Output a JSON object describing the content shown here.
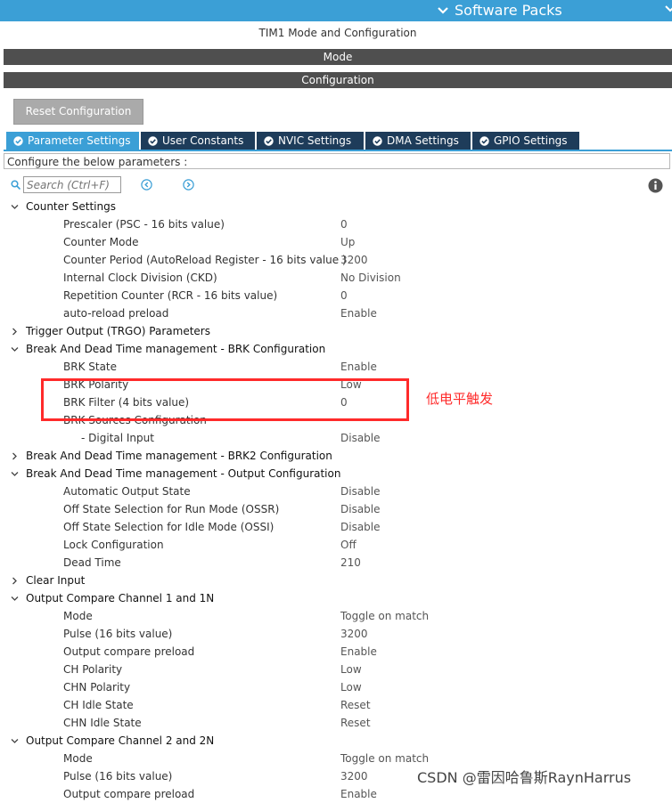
{
  "topbar": {
    "software_packs": "Software Packs"
  },
  "panel": {
    "title": "TIM1 Mode and Configuration",
    "mode_bar": "Mode",
    "config_bar": "Configuration",
    "reset_button": "Reset Configuration"
  },
  "tabs": [
    {
      "label": "Parameter Settings",
      "active": true
    },
    {
      "label": "User Constants",
      "active": false
    },
    {
      "label": "NVIC Settings",
      "active": false
    },
    {
      "label": "DMA Settings",
      "active": false
    },
    {
      "label": "GPIO Settings",
      "active": false
    }
  ],
  "config_text": "Configure the below parameters :",
  "search": {
    "placeholder": "Search (Ctrl+F)"
  },
  "tree": [
    {
      "kind": "group",
      "label": "Counter Settings",
      "expanded": true
    },
    {
      "kind": "param",
      "label": "Prescaler (PSC - 16 bits value)",
      "value": "0"
    },
    {
      "kind": "param",
      "label": "Counter Mode",
      "value": "Up"
    },
    {
      "kind": "param",
      "label": "Counter Period (AutoReload Register - 16 bits value )",
      "value": "3200"
    },
    {
      "kind": "param",
      "label": "Internal Clock Division (CKD)",
      "value": "No Division"
    },
    {
      "kind": "param",
      "label": "Repetition Counter (RCR - 16 bits value)",
      "value": "0"
    },
    {
      "kind": "param",
      "label": "auto-reload preload",
      "value": "Enable"
    },
    {
      "kind": "group",
      "label": "Trigger Output (TRGO) Parameters",
      "expanded": false
    },
    {
      "kind": "group",
      "label": "Break And Dead Time management - BRK Configuration",
      "expanded": true
    },
    {
      "kind": "param",
      "label": "BRK State",
      "value": "Enable"
    },
    {
      "kind": "param",
      "label": "BRK Polarity",
      "value": "Low"
    },
    {
      "kind": "param",
      "label": "BRK Filter (4 bits value)",
      "value": "0"
    },
    {
      "kind": "param",
      "label": "BRK Sources Configuration",
      "value": ""
    },
    {
      "kind": "sub",
      "label": "- Digital Input",
      "value": "Disable"
    },
    {
      "kind": "group",
      "label": "Break And Dead Time management - BRK2 Configuration",
      "expanded": false
    },
    {
      "kind": "group",
      "label": "Break And Dead Time management - Output Configuration",
      "expanded": true
    },
    {
      "kind": "param",
      "label": "Automatic Output State",
      "value": "Disable"
    },
    {
      "kind": "param",
      "label": "Off State Selection for Run Mode (OSSR)",
      "value": "Disable"
    },
    {
      "kind": "param",
      "label": "Off State Selection for Idle Mode (OSSI)",
      "value": "Disable"
    },
    {
      "kind": "param",
      "label": "Lock Configuration",
      "value": "Off"
    },
    {
      "kind": "param",
      "label": "Dead Time",
      "value": "210"
    },
    {
      "kind": "group",
      "label": "Clear Input",
      "expanded": false
    },
    {
      "kind": "group",
      "label": "Output Compare Channel 1 and 1N",
      "expanded": true
    },
    {
      "kind": "param",
      "label": "Mode",
      "value": "Toggle on match"
    },
    {
      "kind": "param",
      "label": "Pulse (16 bits value)",
      "value": "3200"
    },
    {
      "kind": "param",
      "label": "Output compare preload",
      "value": "Enable"
    },
    {
      "kind": "param",
      "label": "CH Polarity",
      "value": "Low"
    },
    {
      "kind": "param",
      "label": "CHN Polarity",
      "value": "Low"
    },
    {
      "kind": "param",
      "label": "CH Idle State",
      "value": "Reset"
    },
    {
      "kind": "param",
      "label": "CHN Idle State",
      "value": "Reset"
    },
    {
      "kind": "group",
      "label": "Output Compare Channel 2 and 2N",
      "expanded": true
    },
    {
      "kind": "param",
      "label": "Mode",
      "value": "Toggle on match"
    },
    {
      "kind": "param",
      "label": "Pulse (16 bits value)",
      "value": "3200"
    },
    {
      "kind": "param",
      "label": "Output compare preload",
      "value": "Enable"
    }
  ],
  "annotation": {
    "note": "低电平触发"
  },
  "watermark": "CSDN @雷因哈鲁斯RaynHarrus",
  "colors": {
    "accent": "#3b9fd6",
    "tab_dark": "#1e3c5a",
    "bar": "#4f4f4f",
    "highlight": "#ff2a2a"
  }
}
